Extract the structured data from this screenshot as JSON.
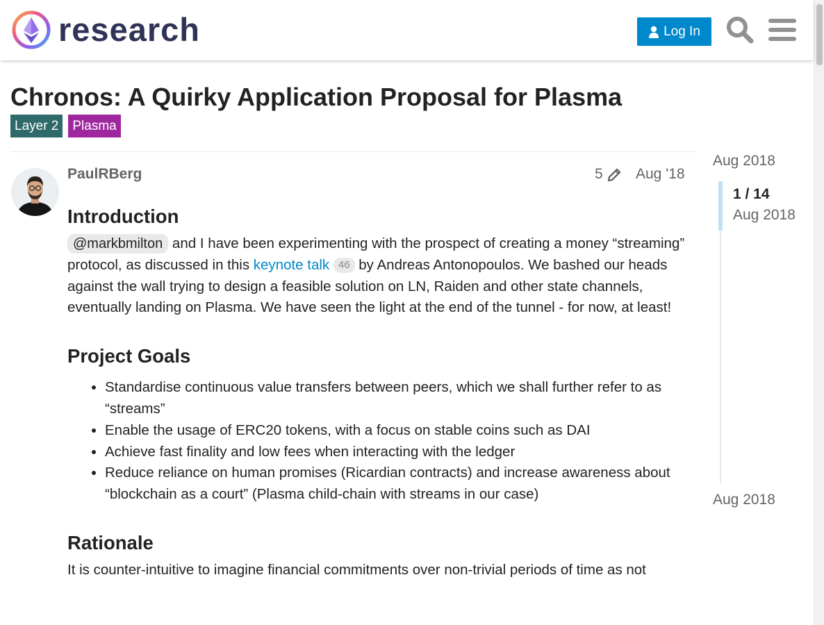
{
  "header": {
    "logo_text": "research",
    "login_label": "Log In"
  },
  "topic": {
    "title": "Chronos: A Quirky Application Proposal for Plasma",
    "tags": [
      "Layer 2",
      "Plasma"
    ]
  },
  "post": {
    "author": "PaulRBerg",
    "edit_count": "5",
    "date": "Aug '18",
    "intro_heading": "Introduction",
    "mention": "@markbmilton",
    "intro_text_1": " and I have been experimenting with the prospect of creating a money “streaming” protocol, as discussed in this ",
    "link_text": "keynote talk",
    "link_clicks": "46",
    "intro_text_2": " by Andreas Antonopoulos. We bashed our heads against the wall trying to design a feasible solution on LN, Raiden and other state channels, eventually landing on Plasma. We have seen the light at the end of the tunnel - for now, at least!",
    "goals_heading": "Project Goals",
    "goals": [
      "Standardise continuous value transfers between peers, which we shall further refer to as “streams”",
      "Enable the usage of ERC20 tokens, with a focus on stable coins such as DAI",
      "Achieve fast finality and low fees when interacting with the ledger",
      "Reduce reliance on human promises (Ricardian contracts) and increase awareness about “blockchain as a court” (Plasma child-chain with streams in our case)"
    ],
    "rationale_heading": "Rationale",
    "rationale_text": "It is counter-intuitive to imagine financial commitments over non-trivial periods of time as not"
  },
  "timeline": {
    "start_date": "Aug 2018",
    "position": "1 / 14",
    "current_date": "Aug 2018",
    "end_date": "Aug 2018"
  },
  "colors": {
    "accent": "#0088cc",
    "tag_layer2": "#2e6a6a",
    "tag_plasma": "#9e279e",
    "logo_text": "#2f3357"
  }
}
